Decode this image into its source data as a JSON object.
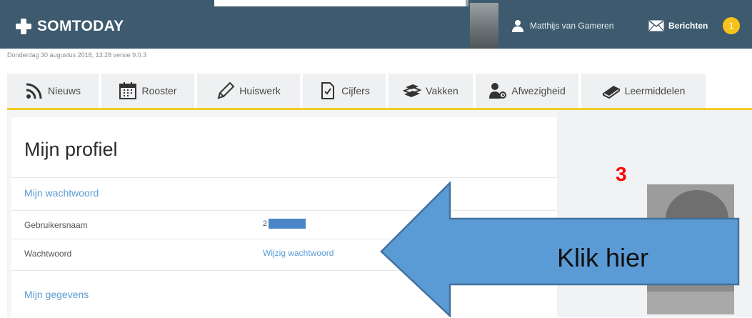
{
  "header": {
    "brand": "SOMTODAY",
    "user_name": "Matthijs van Gameren",
    "messages_label": "Berichten",
    "messages_badge": "1"
  },
  "meta": {
    "info_line": "Donderdag 30 augustus 2018, 13:28 versie 9.0.3"
  },
  "nav": {
    "tabs": [
      {
        "label": "Nieuws",
        "icon": "rss-icon"
      },
      {
        "label": "Rooster",
        "icon": "calendar-icon"
      },
      {
        "label": "Huiswerk",
        "icon": "pencil-icon"
      },
      {
        "label": "Cijfers",
        "icon": "document-check-icon"
      },
      {
        "label": "Vakken",
        "icon": "books-icon"
      },
      {
        "label": "Afwezigheid",
        "icon": "user-absence-icon"
      },
      {
        "label": "Leermiddelen",
        "icon": "book-icon"
      }
    ]
  },
  "profile": {
    "title": "Mijn profiel",
    "password_section": "Mijn wachtwoord",
    "username_label": "Gebruikersnaam",
    "username_prefix": "2",
    "password_label": "Wachtwoord",
    "change_password_link": "Wijzig wachtwoord",
    "details_section": "Mijn gegevens"
  },
  "annotation": {
    "step_number": "3",
    "arrow_text": "Klik hier",
    "arrow_fill": "#5b9bd5",
    "arrow_stroke": "#41719c",
    "step_color": "#ff0000"
  },
  "colors": {
    "header_bg": "#3d5a6e",
    "accent_yellow": "#f2cb2a",
    "link_blue": "#5b9bd5",
    "badge": "#f6c21b"
  }
}
